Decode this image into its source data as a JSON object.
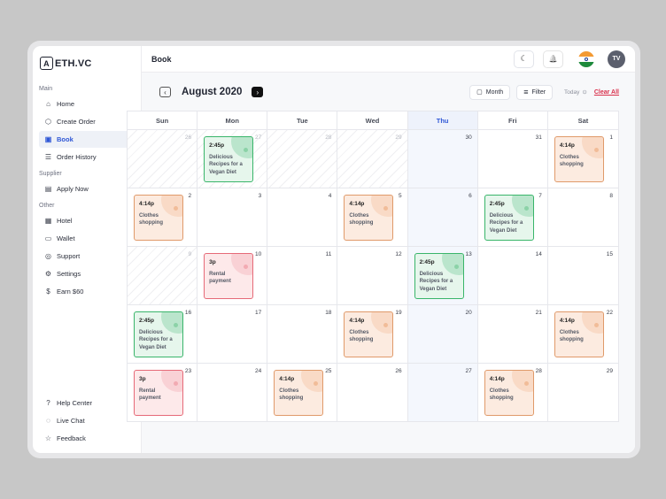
{
  "brand": {
    "name": "ETH.VC",
    "mark": "A"
  },
  "sidebar": {
    "sections": [
      {
        "title": "Main",
        "items": [
          {
            "label": "Home",
            "icon": "⌂",
            "iconName": "home-icon"
          },
          {
            "label": "Create Order",
            "icon": "⬡",
            "iconName": "box-icon"
          },
          {
            "label": "Book",
            "icon": "▣",
            "iconName": "book-icon",
            "active": true
          },
          {
            "label": "Order History",
            "icon": "☰",
            "iconName": "history-icon"
          }
        ]
      },
      {
        "title": "Supplier",
        "items": [
          {
            "label": "Apply Now",
            "icon": "▤",
            "iconName": "briefcase-icon"
          }
        ]
      },
      {
        "title": "Other",
        "items": [
          {
            "label": "Hotel",
            "icon": "▦",
            "iconName": "hotel-icon"
          },
          {
            "label": "Wallet",
            "icon": "▭",
            "iconName": "wallet-icon"
          },
          {
            "label": "Support",
            "icon": "◎",
            "iconName": "support-icon"
          },
          {
            "label": "Settings",
            "icon": "⚙",
            "iconName": "gear-icon"
          },
          {
            "label": "Earn $60",
            "icon": "$",
            "iconName": "dollar-icon"
          }
        ]
      }
    ],
    "bottom": [
      {
        "label": "Help Center",
        "icon": "?",
        "iconName": "help-icon"
      },
      {
        "label": "Live Chat",
        "icon": "◌",
        "iconName": "chat-icon"
      },
      {
        "label": "Feedback",
        "icon": "☆",
        "iconName": "feedback-icon"
      }
    ]
  },
  "topbar": {
    "title": "Book",
    "theme_icon": "☾",
    "bell_icon": "🔔",
    "avatar": "TV",
    "flag_colors": [
      "#f39a33",
      "#ffffff",
      "#1e8a3c"
    ]
  },
  "calendar": {
    "month_label": "August 2020",
    "prev_icon": "‹",
    "next_icon": "›",
    "view_label": "Month",
    "view_icon": "▢",
    "filter_label": "Filter",
    "filter_icon": "≡",
    "today_label": "Today",
    "today_icon": "⊙",
    "clear_label": "Clear All",
    "weekdays": [
      "Sun",
      "Mon",
      "Tue",
      "Wed",
      "Thu",
      "Fri",
      "Sat"
    ],
    "today_col": 4,
    "colors": {
      "green": "#39b56a",
      "orange": "#e09a6a",
      "red": "#e66a78",
      "accent": "#2f57d6"
    },
    "days": [
      {
        "n": "26",
        "muted": true
      },
      {
        "n": "27",
        "muted": true
      },
      {
        "n": "28",
        "muted": true
      },
      {
        "n": "29",
        "muted": true
      },
      {
        "n": "30",
        "muted": true
      },
      {
        "n": "31"
      },
      {
        "n": "1"
      },
      {
        "n": "2"
      },
      {
        "n": "3"
      },
      {
        "n": "4"
      },
      {
        "n": "5"
      },
      {
        "n": "6"
      },
      {
        "n": "7"
      },
      {
        "n": "8"
      },
      {
        "n": "9",
        "muted": true
      },
      {
        "n": "10"
      },
      {
        "n": "11"
      },
      {
        "n": "12"
      },
      {
        "n": "13"
      },
      {
        "n": "14"
      },
      {
        "n": "15"
      },
      {
        "n": "16"
      },
      {
        "n": "17"
      },
      {
        "n": "18"
      },
      {
        "n": "19"
      },
      {
        "n": "20"
      },
      {
        "n": "21"
      },
      {
        "n": "22"
      },
      {
        "n": "23"
      },
      {
        "n": "24"
      },
      {
        "n": "25"
      },
      {
        "n": "26"
      },
      {
        "n": "27"
      },
      {
        "n": "28"
      },
      {
        "n": "29"
      }
    ],
    "events": [
      {
        "day": 1,
        "time": "2:45p",
        "title": "Delicious Recipes for a Vegan Diet",
        "color": "green"
      },
      {
        "day": 6,
        "time": "4:14p",
        "title": "Clothes shopping",
        "color": "orange"
      },
      {
        "day": 7,
        "time": "4:14p",
        "title": "Clothes shopping",
        "color": "orange"
      },
      {
        "day": 10,
        "time": "4:14p",
        "title": "Clothes shopping",
        "color": "orange"
      },
      {
        "day": 12,
        "time": "2:45p",
        "title": "Delicious Recipes for a Vegan Diet",
        "color": "green"
      },
      {
        "day": 15,
        "time": "3p",
        "title": "Rental payment",
        "color": "red"
      },
      {
        "day": 18,
        "time": "2:45p",
        "title": "Delicious Recipes for a Vegan Diet",
        "color": "green"
      },
      {
        "day": 21,
        "time": "2:45p",
        "title": "Delicious Recipes for a Vegan Diet",
        "color": "green"
      },
      {
        "day": 24,
        "time": "4:14p",
        "title": "Clothes shopping",
        "color": "orange"
      },
      {
        "day": 27,
        "time": "4:14p",
        "title": "Clothes shopping",
        "color": "orange"
      },
      {
        "day": 28,
        "time": "3p",
        "title": "Rental payment",
        "color": "red"
      },
      {
        "day": 30,
        "time": "4:14p",
        "title": "Clothes shopping",
        "color": "orange"
      },
      {
        "day": 33,
        "time": "4:14p",
        "title": "Clothes shopping",
        "color": "orange"
      }
    ]
  }
}
